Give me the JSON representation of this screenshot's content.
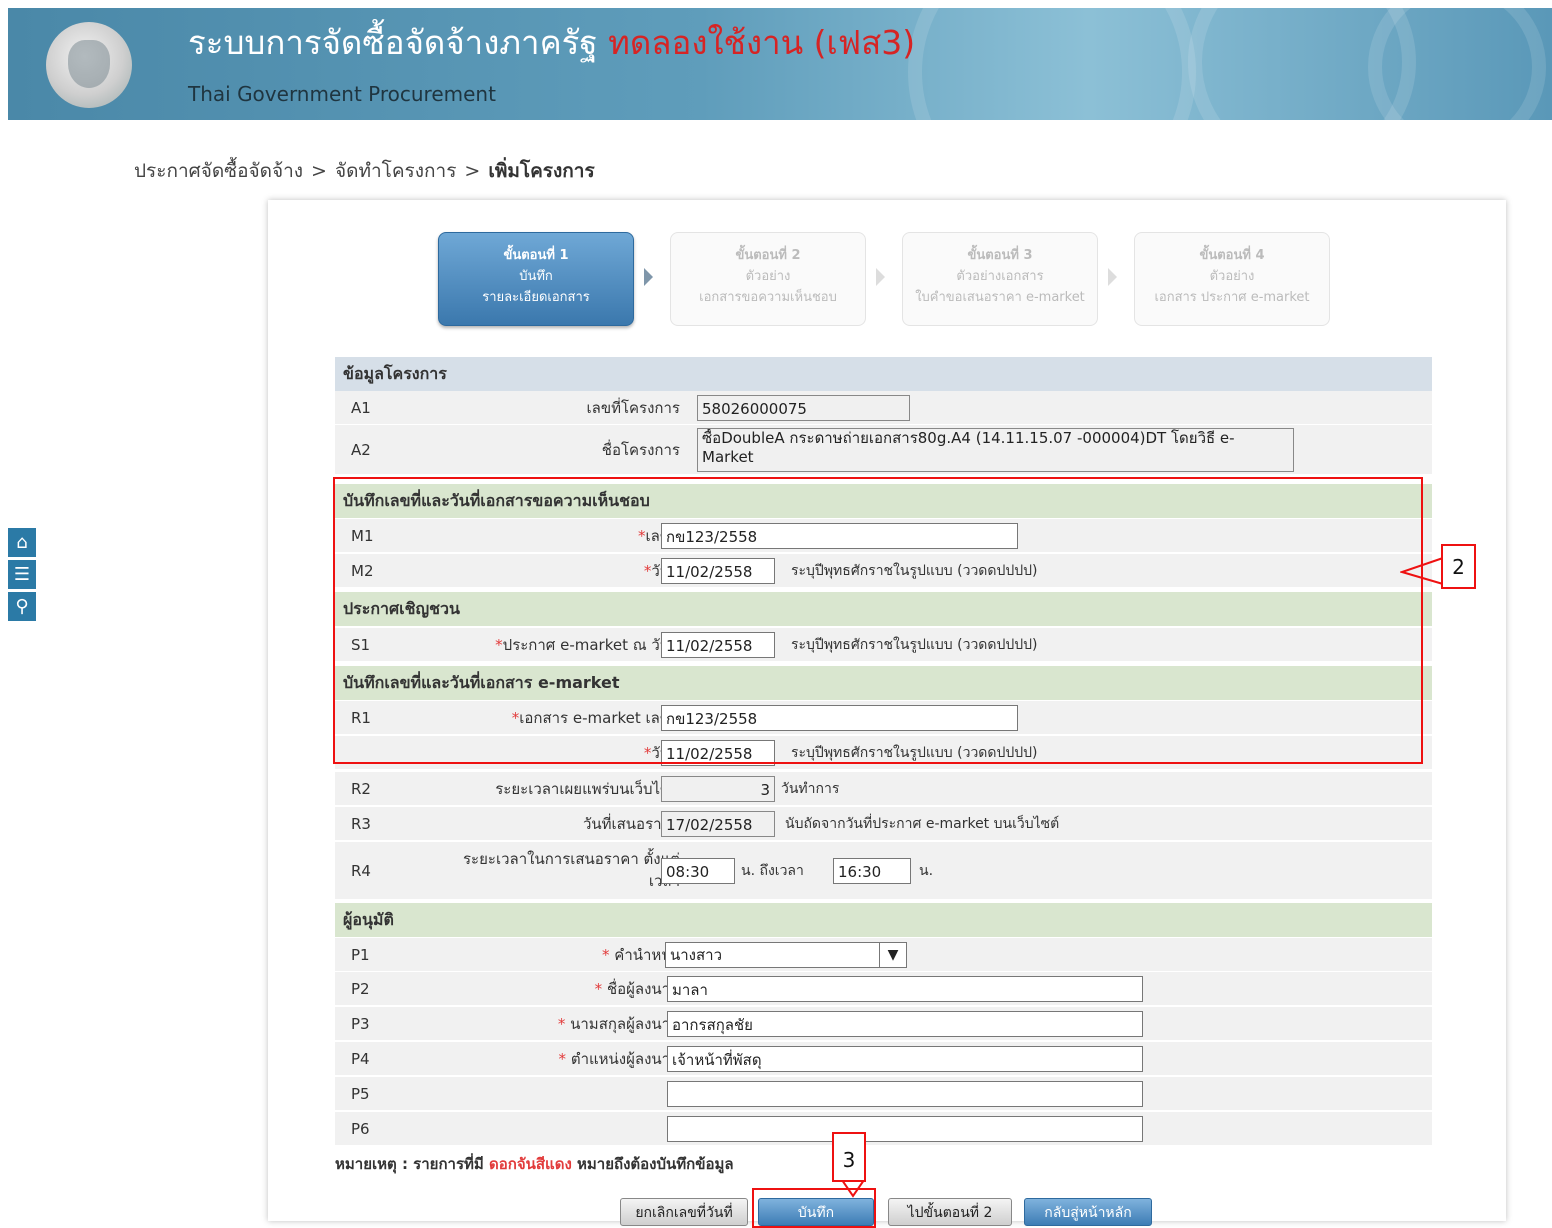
{
  "header": {
    "title_main": "ระบบการจัดซื้อจัดจ้างภาครัฐ",
    "title_trial": "ทดลองใช้งาน (เฟส3)",
    "subtitle": "Thai Government Procurement"
  },
  "breadcrumb": {
    "item1": "ประกาศจัดซื้อจัดจ้าง",
    "item2": "จัดทำโครงการ",
    "item3": "เพิ่มโครงการ",
    "separator": ">"
  },
  "side_icons": [
    "home-icon",
    "menu-icon",
    "search-icon"
  ],
  "steps": [
    {
      "title": "ขั้นตอนที่ 1",
      "line1": "บันทึก",
      "line2": "รายละเอียดเอกสาร",
      "active": true
    },
    {
      "title": "ขั้นตอนที่ 2",
      "line1": "ตัวอย่าง",
      "line2": "เอกสารขอความเห็นชอบ",
      "active": false
    },
    {
      "title": "ขั้นตอนที่ 3",
      "line1": "ตัวอย่างเอกสาร",
      "line2": "ใบคำขอเสนอราคา e-market",
      "active": false
    },
    {
      "title": "ขั้นตอนที่ 4",
      "line1": "ตัวอย่าง",
      "line2": "เอกสาร ประกาศ e-market",
      "active": false
    }
  ],
  "project": {
    "section": "ข้อมูลโครงการ",
    "a1": {
      "code": "A1",
      "label": "เลขที่โครงการ",
      "value": "58026000075"
    },
    "a2": {
      "code": "A2",
      "label": "ชื่อโครงการ",
      "value_line1": "ซื้อDoubleA กระดาษถ่ายเอกสาร80g.A4 (14.11.15.07 -000004)DT โดยวิธี e-",
      "value_line2": "Market"
    }
  },
  "approval_doc": {
    "section": "บันทึกเลขที่และวันที่เอกสารขอความเห็นชอบ",
    "m1": {
      "code": "M1",
      "label": "เลขที่",
      "value": "กข123/2558"
    },
    "m2": {
      "code": "M2",
      "label": "วันที่",
      "value": "11/02/2558",
      "hint": "ระบุปีพุทธศักราชในรูปแบบ (ววดดปปปป)"
    }
  },
  "invite": {
    "section": "ประกาศเชิญชวน",
    "s1": {
      "code": "S1",
      "label": "ประกาศ e-market ณ วันที่",
      "value": "11/02/2558",
      "hint": "ระบุปีพุทธศักราชในรูปแบบ (ววดดปปปป)"
    }
  },
  "emarket_doc": {
    "section": "บันทึกเลขที่และวันที่เอกสาร e-market",
    "r1": {
      "code": "R1",
      "label": "เอกสาร e-market เลขที่",
      "value": "กข123/2558"
    },
    "r1_date": {
      "label": "วันที่",
      "value": "11/02/2558",
      "hint": "ระบุปีพุทธศักราชในรูปแบบ (ววดดปปปป)"
    },
    "r2": {
      "code": "R2",
      "label": "ระยะเวลาเผยแพร่บนเว็บไซต์",
      "value": "3",
      "unit": "วันทำการ"
    },
    "r3": {
      "code": "R3",
      "label": "วันที่เสนอราคา",
      "value": "17/02/2558",
      "hint": "นับถัดจากวันที่ประกาศ e-market บนเว็บไซต์"
    },
    "r4": {
      "code": "R4",
      "label_line1": "ระยะเวลาในการเสนอราคา ตั้งแต่",
      "label_line2": "เวลา",
      "from": "08:30",
      "mid": "น. ถึงเวลา",
      "to": "16:30",
      "end": "น."
    }
  },
  "approver": {
    "section": "ผู้อนุมัติ",
    "p1": {
      "code": "P1",
      "label": "คำนำหน้า",
      "value": "นางสาว"
    },
    "p2": {
      "code": "P2",
      "label": "ชื่อผู้ลงนาม",
      "value": "มาลา"
    },
    "p3": {
      "code": "P3",
      "label": "นามสกุลผู้ลงนาม",
      "value": "อากรสกุลชัย"
    },
    "p4": {
      "code": "P4",
      "label": "ตำแหน่งผู้ลงนาม",
      "value": "เจ้าหน้าที่พัสดุ"
    },
    "p5": {
      "code": "P5",
      "value": ""
    },
    "p6": {
      "code": "P6",
      "value": ""
    }
  },
  "required_mark": "*",
  "note": {
    "prefix": "หมายเหตุ : รายการที่มี",
    "highlight": "ดอกจันสีแดง",
    "suffix": "หมายถึงต้องบันทึกข้อมูล"
  },
  "buttons": {
    "cancel": "ยกเลิกเลขที่วันที่",
    "save": "บันทึก",
    "next": "ไปขั้นตอนที่ 2",
    "back": "กลับสู่หน้าหลัก"
  },
  "callouts": {
    "c2": "2",
    "c3": "3"
  },
  "colors": {
    "accent": "#3b78ad",
    "required": "#e23b3b",
    "annotation": "#ee1111",
    "section_blue": "#d6dfe8",
    "section_green": "#d9e6cf"
  }
}
